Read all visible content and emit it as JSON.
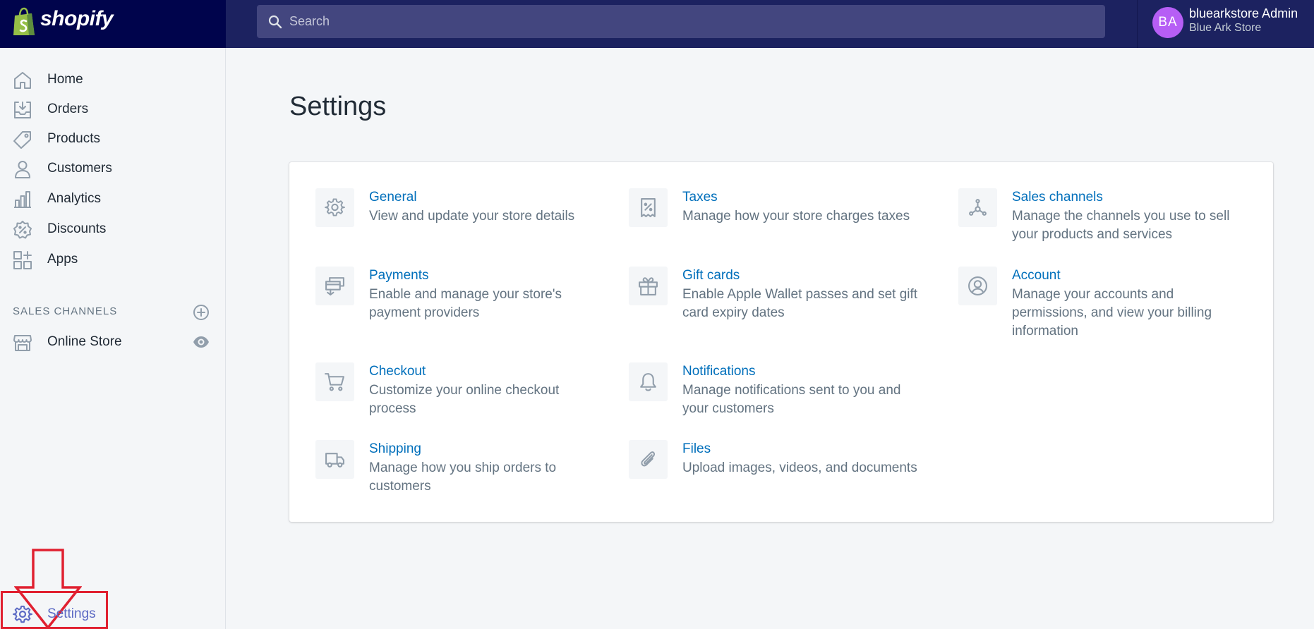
{
  "brand": {
    "name": "shopify"
  },
  "search": {
    "placeholder": "Search"
  },
  "user": {
    "initials": "BA",
    "name": "bluearkstore Admin",
    "store": "Blue Ark Store"
  },
  "sidebar": {
    "items": [
      {
        "label": "Home",
        "icon": "home-icon"
      },
      {
        "label": "Orders",
        "icon": "orders-icon"
      },
      {
        "label": "Products",
        "icon": "tag-icon"
      },
      {
        "label": "Customers",
        "icon": "person-icon"
      },
      {
        "label": "Analytics",
        "icon": "bar-chart-icon"
      },
      {
        "label": "Discounts",
        "icon": "discount-icon"
      },
      {
        "label": "Apps",
        "icon": "apps-icon"
      }
    ],
    "sales_channels_heading": "SALES CHANNELS",
    "online_store": "Online Store",
    "settings": "Settings"
  },
  "page": {
    "title": "Settings"
  },
  "settings_items": [
    {
      "title": "General",
      "description": "View and update your store details",
      "icon": "gear-icon"
    },
    {
      "title": "Taxes",
      "description": "Manage how your store charges taxes",
      "icon": "receipt-icon"
    },
    {
      "title": "Sales channels",
      "description": "Manage the channels you use to sell your products and services",
      "icon": "channels-icon"
    },
    {
      "title": "Payments",
      "description": "Enable and manage your store's payment providers",
      "icon": "payments-icon"
    },
    {
      "title": "Gift cards",
      "description": "Enable Apple Wallet passes and set gift card expiry dates",
      "icon": "gift-icon"
    },
    {
      "title": "Account",
      "description": "Manage your accounts and permissions, and view your billing information",
      "icon": "account-icon"
    },
    {
      "title": "Checkout",
      "description": "Customize your online checkout process",
      "icon": "cart-icon"
    },
    {
      "title": "Notifications",
      "description": "Manage notifications sent to you and your customers",
      "icon": "bell-icon"
    },
    {
      "title": "Shipping",
      "description": "Manage how you ship orders to customers",
      "icon": "truck-icon"
    },
    {
      "title": "Files",
      "description": "Upload images, videos, and documents",
      "icon": "paperclip-icon"
    }
  ],
  "colors": {
    "topbar": "#1c2260",
    "logo_bg": "#00044c",
    "link": "#006fbb",
    "avatar": "#b65ef5",
    "highlight": "#e02030",
    "active": "#5c6ac4"
  }
}
